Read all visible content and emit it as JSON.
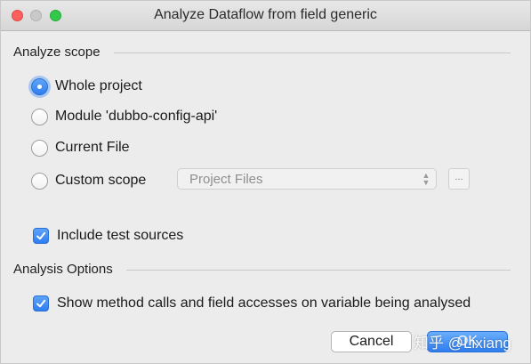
{
  "window": {
    "title": "Analyze Dataflow from field generic"
  },
  "scope": {
    "header": "Analyze scope",
    "options": [
      {
        "label": "Whole project",
        "selected": true
      },
      {
        "label": "Module 'dubbo-config-api'",
        "selected": false
      },
      {
        "label": "Current File",
        "selected": false
      },
      {
        "label": "Custom scope",
        "selected": false
      }
    ],
    "custom_scope_value": "Project Files",
    "browse_label": "...",
    "include_tests_label": "Include test sources",
    "include_tests_checked": true
  },
  "analysis": {
    "header": "Analysis Options",
    "show_calls_label": "Show method calls and field accesses on variable being analysed",
    "show_calls_checked": true
  },
  "buttons": {
    "cancel": "Cancel",
    "ok": "OK"
  },
  "watermark": "知乎 @Lixiang",
  "colors": {
    "accent": "#2f7ef0",
    "close": "#fc605c",
    "minimize": "#c9c9c9",
    "maximize": "#34c84a"
  }
}
